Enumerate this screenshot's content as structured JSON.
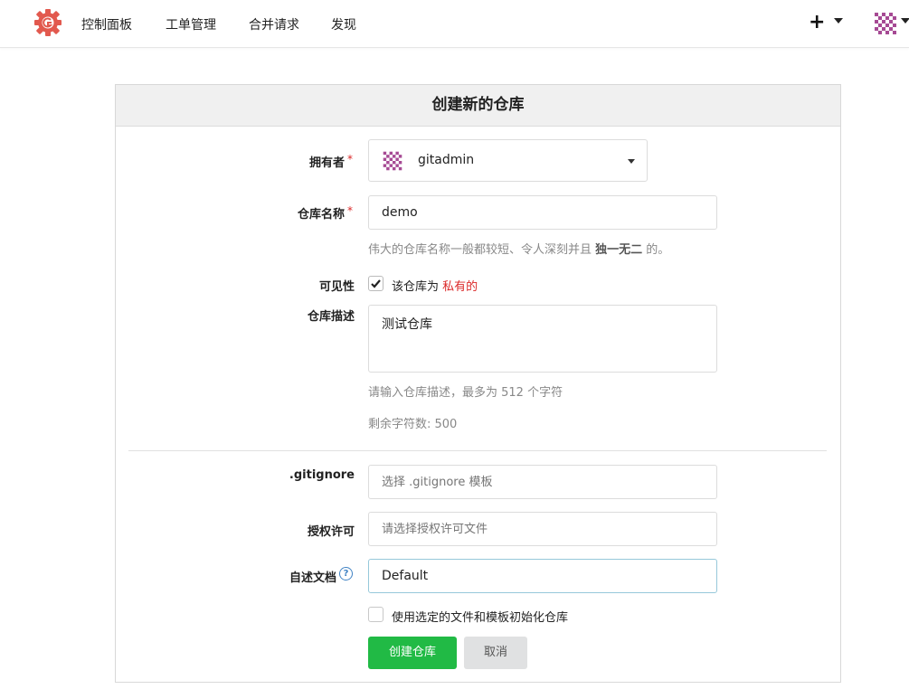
{
  "navbar": {
    "items": [
      "控制面板",
      "工单管理",
      "合并请求",
      "发现"
    ],
    "plus": "+"
  },
  "form": {
    "title": "创建新的仓库",
    "owner": {
      "label": "拥有者",
      "required_mark": "*",
      "value": "gitadmin"
    },
    "repo_name": {
      "label": "仓库名称",
      "required_mark": "*",
      "value": "demo",
      "help_prefix": "伟大的仓库名称一般都较短、令人深刻并且 ",
      "help_bold": "独一无二",
      "help_suffix": " 的。"
    },
    "visibility": {
      "label": "可见性",
      "checked": true,
      "text": "该仓库为 ",
      "highlight": "私有的"
    },
    "description": {
      "label": "仓库描述",
      "value": "测试仓库",
      "help": "请输入仓库描述，最多为 512 个字符",
      "remaining": "剩余字符数: 500"
    },
    "gitignore": {
      "label": ".gitignore",
      "placeholder": "选择 .gitignore 模板"
    },
    "license": {
      "label": "授权许可",
      "placeholder": "请选择授权许可文件"
    },
    "readme": {
      "label": "自述文档",
      "value": "Default",
      "help_icon": "?"
    },
    "auto_init": {
      "checked": false,
      "label": "使用选定的文件和模板初始化仓库"
    },
    "submit_label": "创建仓库",
    "cancel_label": "取消"
  },
  "colors": {
    "primary": "#21ba45",
    "danger": "#db2828",
    "brand": "#e2594e",
    "avatar": "#a64a94"
  }
}
